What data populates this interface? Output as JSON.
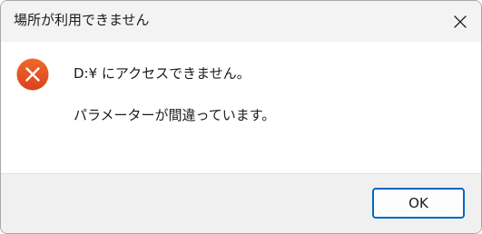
{
  "window": {
    "title": "場所が利用できません",
    "close_icon": "close-icon"
  },
  "message": {
    "icon": "error-icon",
    "line1": "D:¥ にアクセスできません。",
    "line2": "パラメーターが間違っています。"
  },
  "footer": {
    "ok_label": "OK"
  },
  "colors": {
    "titlebar_bg": "#f3f3f3",
    "footer_bg": "#f0f0f0",
    "error_red": "#c42b1c",
    "error_orange": "#e65c21",
    "button_border": "#0067c0"
  }
}
